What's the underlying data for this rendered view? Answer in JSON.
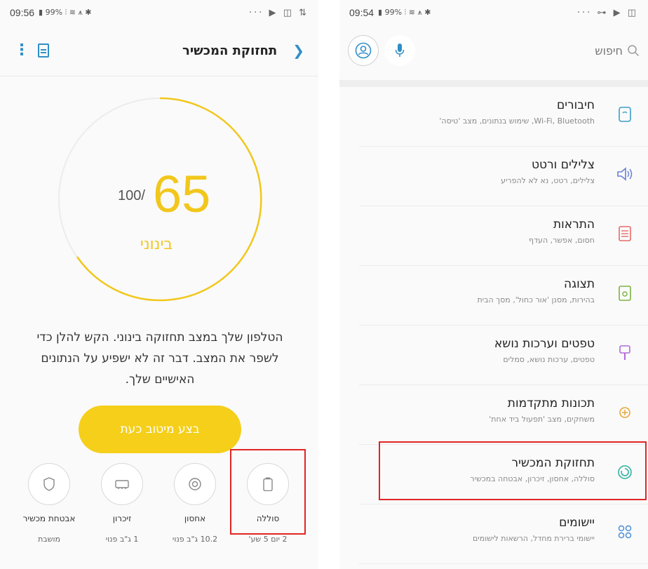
{
  "left": {
    "status_bar": {
      "time": "09:56",
      "left_icons": "▮ 99% ⫶ ≋ ⩚ ✱",
      "right_icons": "··· ▶ ◫ ⇅"
    },
    "header": {
      "title": "תחזוקת המכשיר",
      "menu_icon": "more-vert-icon",
      "report_icon": "document-icon",
      "back_icon": "chevron-right-icon"
    },
    "score": {
      "value": "65",
      "max": "100/",
      "status": "בינוני"
    },
    "description": "הטלפון שלך במצב תחזוקה בינוני. הקש להלן כדי לשפר את המצב. דבר זה לא ישפיע על הנתונים האישיים שלך.",
    "optimize_button": "בצע מיטוב כעת",
    "tiles": [
      {
        "label": "סוללה",
        "sub": "2 יום 5 שע'",
        "icon": "battery-icon"
      },
      {
        "label": "אחסון",
        "sub": "10.2 ג\"ב פנוי",
        "icon": "storage-icon"
      },
      {
        "label": "זיכרון",
        "sub": "1 ג\"ב פנוי",
        "icon": "memory-icon"
      },
      {
        "label": "אבטחת מכשיר",
        "sub": "מושבת",
        "icon": "shield-icon"
      }
    ],
    "colors": {
      "accent": "#f2c71c",
      "link": "#2f8fc7",
      "highlight": "#e12525"
    }
  },
  "right": {
    "status_bar": {
      "time": "09:54",
      "left_icons": "▮ 99% ⫶ ≋ ⩚ ✱",
      "right_icons": "··· ⊶ ▶ ◫"
    },
    "search": {
      "placeholder": "חיפוש"
    },
    "items": [
      {
        "title": "חיבורים",
        "desc": "Wi-Fi, Bluetooth, שימוש בנתונים, מצב 'טיסה'",
        "icon": "connections-icon",
        "color": "#3aa0c9"
      },
      {
        "title": "צלילים ורטט",
        "desc": "צלילים, רטט, נא לא להפריע",
        "icon": "sound-icon",
        "color": "#6a7fd8"
      },
      {
        "title": "התראות",
        "desc": "חסום, אפשר, העדף",
        "icon": "notifications-icon",
        "color": "#e66a6a"
      },
      {
        "title": "תצוגה",
        "desc": "בהירות, מסנן 'אור כחול', מסך הבית",
        "icon": "display-icon",
        "color": "#7cb342"
      },
      {
        "title": "טפטים וערכות נושא",
        "desc": "טפטים, ערכות נושא, סמלים",
        "icon": "wallpaper-icon",
        "color": "#b46ad8"
      },
      {
        "title": "תכונות מתקדמות",
        "desc": "משחקים, מצב 'תפעול ביד אחת'",
        "icon": "advanced-features-icon",
        "color": "#e8a93a"
      },
      {
        "title": "תחזוקת המכשיר",
        "desc": "סוללה, אחסון, זיכרון, אבטחה במכשיר",
        "icon": "device-care-icon",
        "color": "#35b3a1"
      },
      {
        "title": "יישומים",
        "desc": "יישומי ברירת מחדל, הרשאות לישומים",
        "icon": "apps-icon",
        "color": "#4a90d9"
      }
    ]
  }
}
